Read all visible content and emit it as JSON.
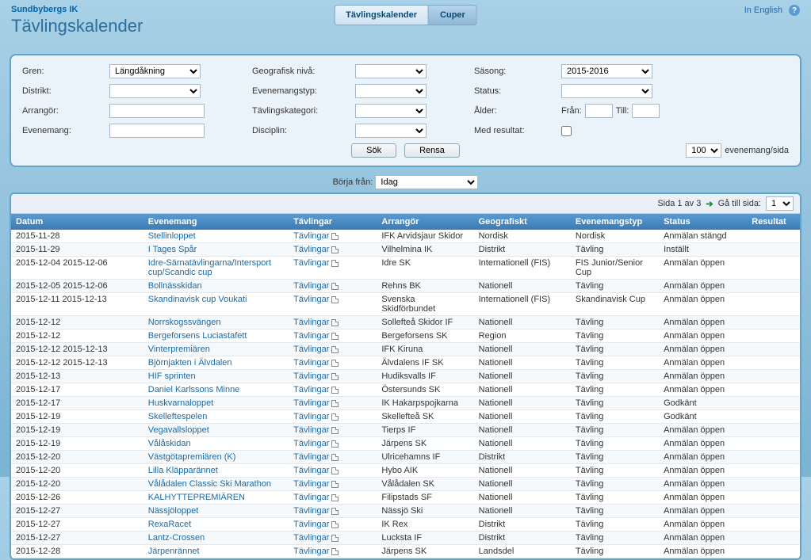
{
  "brand": "Sundbybergs IK",
  "page_title": "Tävlingskalender",
  "tabs": {
    "left": "Tävlingskalender",
    "right": "Cuper"
  },
  "top_right": "In English",
  "filters": {
    "gren_label": "Gren:",
    "gren_value": "Längdåkning",
    "distrikt_label": "Distrikt:",
    "arrangor_label": "Arrangör:",
    "evenemang_label": "Evenemang:",
    "geonivaa_label": "Geografisk nivå:",
    "evtyp_label": "Evenemangstyp:",
    "tkategori_label": "Tävlingskategori:",
    "disciplin_label": "Disciplin:",
    "sasong_label": "Säsong:",
    "sasong_value": "2015-2016",
    "status_label": "Status:",
    "alder_label": "Ålder:",
    "alder_fran": "Från:",
    "alder_till": "Till:",
    "medres_label": "Med resultat:",
    "sok": "Sök",
    "rensa": "Rensa",
    "perpage_value": "100",
    "perpage_suffix": "evenemang/sida"
  },
  "start": {
    "label": "Börja från:",
    "value": "Idag"
  },
  "pager": {
    "text": "Sida 1 av 3",
    "goto": "Gå till sida:",
    "page_value": "1"
  },
  "headers": {
    "datum": "Datum",
    "evenemang": "Evenemang",
    "tavlingar": "Tävlingar",
    "arrangor": "Arrangör",
    "geografiskt": "Geografiskt",
    "evtyp": "Evenemangstyp",
    "status": "Status",
    "resultat": "Resultat"
  },
  "tavlingar_label": "Tävlingar",
  "rows": [
    {
      "datum": "2015-11-28",
      "ev": "Stellinloppet",
      "arr": "IFK Arvidsjaur Skidor",
      "geo": "Nordisk",
      "typ": "Nordisk",
      "status": "Anmälan stängd"
    },
    {
      "datum": "2015-11-29",
      "ev": "I Tages Spår",
      "arr": "Vilhelmina IK",
      "geo": "Distrikt",
      "typ": "Tävling",
      "status": "Inställt"
    },
    {
      "datum": "2015-12-04 2015-12-06",
      "ev": "Idre-Särnatävlingarna/Intersport cup/Scandic cup",
      "arr": "Idre SK",
      "geo": "Internationell (FIS)",
      "typ": "FIS Junior/Senior Cup",
      "status": "Anmälan öppen"
    },
    {
      "datum": "2015-12-05 2015-12-06",
      "ev": "Bollnässkidan",
      "arr": "Rehns BK",
      "geo": "Nationell",
      "typ": "Tävling",
      "status": "Anmälan öppen"
    },
    {
      "datum": "2015-12-11 2015-12-13",
      "ev": "Skandinavisk cup Voukati",
      "arr": "Svenska Skidförbundet",
      "geo": "Internationell (FIS)",
      "typ": "Skandinavisk Cup",
      "status": "Anmälan öppen"
    },
    {
      "datum": "2015-12-12",
      "ev": "Norrskogssvängen",
      "arr": "Sollefteå Skidor IF",
      "geo": "Nationell",
      "typ": "Tävling",
      "status": "Anmälan öppen"
    },
    {
      "datum": "2015-12-12",
      "ev": "Bergeforsens Luciastafett",
      "arr": "Bergeforsens SK",
      "geo": "Region",
      "typ": "Tävling",
      "status": "Anmälan öppen"
    },
    {
      "datum": "2015-12-12 2015-12-13",
      "ev": "Vinterpremiären",
      "arr": "IFK Kiruna",
      "geo": "Nationell",
      "typ": "Tävling",
      "status": "Anmälan öppen"
    },
    {
      "datum": "2015-12-12 2015-12-13",
      "ev": "Björnjakten i Älvdalen",
      "arr": "Älvdalens IF SK",
      "geo": "Nationell",
      "typ": "Tävling",
      "status": "Anmälan öppen"
    },
    {
      "datum": "2015-12-13",
      "ev": "HIF sprinten",
      "arr": "Hudiksvalls IF",
      "geo": "Nationell",
      "typ": "Tävling",
      "status": "Anmälan öppen"
    },
    {
      "datum": "2015-12-17",
      "ev": "Daniel Karlssons Minne",
      "arr": "Östersunds SK",
      "geo": "Nationell",
      "typ": "Tävling",
      "status": "Anmälan öppen"
    },
    {
      "datum": "2015-12-17",
      "ev": "Huskvarnaloppet",
      "arr": "IK Hakarpspojkarna",
      "geo": "Nationell",
      "typ": "Tävling",
      "status": "Godkänt"
    },
    {
      "datum": "2015-12-19",
      "ev": "Skelleftespelen",
      "arr": "Skellefteå SK",
      "geo": "Nationell",
      "typ": "Tävling",
      "status": "Godkänt"
    },
    {
      "datum": "2015-12-19",
      "ev": "Vegavallsloppet",
      "arr": "Tierps IF",
      "geo": "Nationell",
      "typ": "Tävling",
      "status": "Anmälan öppen"
    },
    {
      "datum": "2015-12-19",
      "ev": "Vålåskidan",
      "arr": "Järpens SK",
      "geo": "Nationell",
      "typ": "Tävling",
      "status": "Anmälan öppen"
    },
    {
      "datum": "2015-12-20",
      "ev": "Västgötapremiären (K)",
      "arr": "Ulricehamns IF",
      "geo": "Distrikt",
      "typ": "Tävling",
      "status": "Anmälan öppen"
    },
    {
      "datum": "2015-12-20",
      "ev": "Lilla Kläpparännet",
      "arr": "Hybo AIK",
      "geo": "Nationell",
      "typ": "Tävling",
      "status": "Anmälan öppen"
    },
    {
      "datum": "2015-12-20",
      "ev": "Vålådalen Classic Ski Marathon",
      "arr": "Vålådalen SK",
      "geo": "Nationell",
      "typ": "Tävling",
      "status": "Anmälan öppen"
    },
    {
      "datum": "2015-12-26",
      "ev": "KALHYTTEPREMIÄREN",
      "arr": "Filipstads SF",
      "geo": "Nationell",
      "typ": "Tävling",
      "status": "Anmälan öppen"
    },
    {
      "datum": "2015-12-27",
      "ev": "Nässjöloppet",
      "arr": "Nässjö Ski",
      "geo": "Nationell",
      "typ": "Tävling",
      "status": "Anmälan öppen"
    },
    {
      "datum": "2015-12-27",
      "ev": "RexaRacet",
      "arr": "IK Rex",
      "geo": "Distrikt",
      "typ": "Tävling",
      "status": "Anmälan öppen"
    },
    {
      "datum": "2015-12-27",
      "ev": "Lantz-Crossen",
      "arr": "Lucksta IF",
      "geo": "Distrikt",
      "typ": "Tävling",
      "status": "Anmälan öppen"
    },
    {
      "datum": "2015-12-28",
      "ev": "Järpenrännet",
      "arr": "Järpens SK",
      "geo": "Landsdel",
      "typ": "Tävling",
      "status": "Anmälan öppen"
    }
  ]
}
